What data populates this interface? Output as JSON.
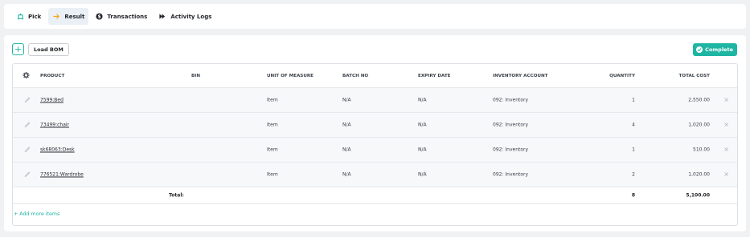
{
  "tabs": [
    {
      "label": "Pick",
      "icon": "robot-icon",
      "color": "#1fb5a3"
    },
    {
      "label": "Result",
      "icon": "arrow-right-icon",
      "color": "#f5a623"
    },
    {
      "label": "Transactions",
      "icon": "currency-circle-icon",
      "color": "#23262b"
    },
    {
      "label": "Activity Logs",
      "icon": "chevron-double-right-icon",
      "color": "#23262b"
    }
  ],
  "toolbar": {
    "add_label": "+",
    "load_bom_label": "Load BOM",
    "complete_label": "Complete"
  },
  "table": {
    "headers": {
      "product": "PRODUCT",
      "bin": "BIN",
      "uom": "UNIT OF MEASURE",
      "batch": "BATCH NO",
      "expiry": "EXPIRY DATE",
      "account": "INVENTORY ACCOUNT",
      "quantity": "QUANTITY",
      "total_cost": "TOTAL COST"
    },
    "rows": [
      {
        "product": "7599:Bed",
        "bin": "",
        "uom": "Item",
        "batch": "N/A",
        "expiry": "N/A",
        "account": "092: Inventory",
        "quantity": "1",
        "total_cost": "2,550.00"
      },
      {
        "product": "73499:chair",
        "bin": "",
        "uom": "Item",
        "batch": "N/A",
        "expiry": "N/A",
        "account": "092: Inventory",
        "quantity": "4",
        "total_cost": "1,020.00"
      },
      {
        "product": "sk68063:Desk",
        "bin": "",
        "uom": "Item",
        "batch": "N/A",
        "expiry": "N/A",
        "account": "092: Inventory",
        "quantity": "1",
        "total_cost": "510.00"
      },
      {
        "product": "776521:Wardrobe",
        "bin": "",
        "uom": "Item",
        "batch": "N/A",
        "expiry": "N/A",
        "account": "092: Inventory",
        "quantity": "2",
        "total_cost": "1,020.00"
      }
    ],
    "total": {
      "label": "Total:",
      "quantity": "8",
      "total_cost": "5,100.00"
    }
  },
  "add_more_label": "+ Add more items",
  "colors": {
    "accent": "#1fb5a3",
    "result_arrow": "#f5a623"
  }
}
